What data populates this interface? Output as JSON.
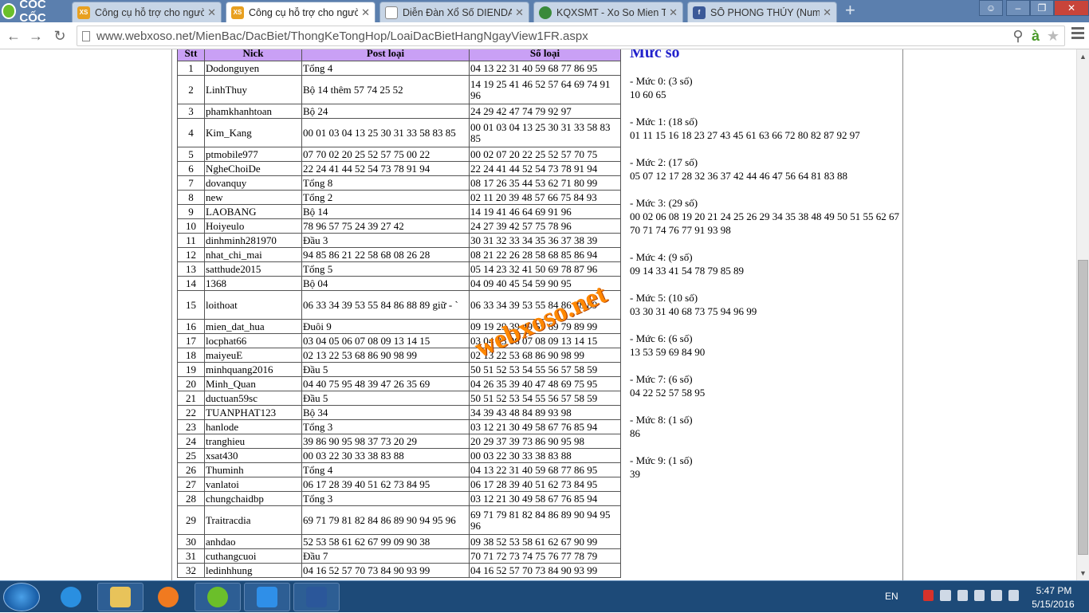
{
  "browser": {
    "brand": "CỐC CỐC",
    "tabs": [
      {
        "label": "Công cụ hỗ trợ cho người",
        "icon": "xoso-favicon",
        "active": false
      },
      {
        "label": "Công cụ hỗ trợ cho người",
        "icon": "xoso-favicon",
        "active": true
      },
      {
        "label": "Diễn Đàn Xổ Số DIENDAN",
        "icon": "page-icon",
        "active": false
      },
      {
        "label": "KQXSMT - Xo So Mien Tru",
        "icon": "kqxs-favicon",
        "active": false
      },
      {
        "label": "SỐ PHONG THỦY (Numer",
        "icon": "facebook-icon",
        "active": false
      }
    ],
    "url": "www.webxoso.net/MienBac/DacBiet/ThongKeTongHop/LoaiDacBietHangNgayView1FR.aspx"
  },
  "table": {
    "headers": [
      "Stt",
      "Nick",
      "Post loại",
      "Số loại"
    ],
    "rows": [
      {
        "stt": "1",
        "nick": "Dodonguyen",
        "post": "Tổng 4",
        "so": "04 13 22 31 40 59 68 77 86 95"
      },
      {
        "stt": "2",
        "nick": "LinhThuy",
        "post": "Bộ 14 thêm 57 74 25 52",
        "so": "14 19 25 41 46 52 57 64 69 74 91 96"
      },
      {
        "stt": "3",
        "nick": "phamkhanhtoan",
        "post": "Bộ 24",
        "so": "24 29 42 47 74 79 92 97"
      },
      {
        "stt": "4",
        "nick": "Kim_Kang",
        "post": "00 01 03 04 13 25 30 31 33 58 83 85",
        "so": "00 01 03 04 13 25 30 31 33 58 83 85"
      },
      {
        "stt": "5",
        "nick": "ptmobile977",
        "post": "07 70 02 20 25 52 57 75 00 22",
        "so": "00 02 07 20 22 25 52 57 70 75"
      },
      {
        "stt": "6",
        "nick": "NgheChoiDe",
        "post": "22 24 41 44 52 54 73 78 91 94",
        "so": "22 24 41 44 52 54 73 78 91 94"
      },
      {
        "stt": "7",
        "nick": "dovanquy",
        "post": "Tổng 8",
        "so": "08 17 26 35 44 53 62 71 80 99"
      },
      {
        "stt": "8",
        "nick": "new",
        "post": "Tổng 2",
        "so": "02 11 20 39 48 57 66 75 84 93"
      },
      {
        "stt": "9",
        "nick": "LAOBANG",
        "post": "Bộ 14",
        "so": "14 19 41 46 64 69 91 96"
      },
      {
        "stt": "10",
        "nick": "Hoiyeulo",
        "post": "78 96 57 75 24 39 27 42",
        "so": "24 27 39 42 57 75 78 96"
      },
      {
        "stt": "11",
        "nick": "dinhminh281970",
        "post": "Đầu 3",
        "so": "30 31 32 33 34 35 36 37 38 39"
      },
      {
        "stt": "12",
        "nick": "nhat_chi_mai",
        "post": "94 85 86 21 22 58 68 08 26 28",
        "so": "08 21 22 26 28 58 68 85 86 94"
      },
      {
        "stt": "13",
        "nick": "satthude2015",
        "post": "Tổng 5",
        "so": "05 14 23 32 41 50 69 78 87 96"
      },
      {
        "stt": "14",
        "nick": "1368",
        "post": "Bộ 04",
        "so": "04 09 40 45 54 59 90 95"
      },
      {
        "stt": "15",
        "nick": "loithoat",
        "post": "06 33 34 39 53 55 84 86 88 89 giữ - `",
        "so": "06 33 34 39 53 55 84 86 88 89"
      },
      {
        "stt": "16",
        "nick": "mien_dat_hua",
        "post": "Đuôi 9",
        "so": "09 19 29 39 49 59 69 79 89 99"
      },
      {
        "stt": "17",
        "nick": "locphat66",
        "post": "03 04 05 06 07 08 09 13 14 15",
        "so": "03 04 05 06 07 08 09 13 14 15"
      },
      {
        "stt": "18",
        "nick": "maiyeuE",
        "post": "02 13 22 53 68 86 90 98 99",
        "so": "02 13 22 53 68 86 90 98 99"
      },
      {
        "stt": "19",
        "nick": "minhquang2016",
        "post": "Đầu 5",
        "so": "50 51 52 53 54 55 56 57 58 59"
      },
      {
        "stt": "20",
        "nick": "Minh_Quan",
        "post": "04 40 75 95 48 39 47 26 35 69",
        "so": "04 26 35 39 40 47 48 69 75 95"
      },
      {
        "stt": "21",
        "nick": "ductuan59sc",
        "post": "Đầu 5",
        "so": "50 51 52 53 54 55 56 57 58 59"
      },
      {
        "stt": "22",
        "nick": "TUANPHAT123",
        "post": "Bộ 34",
        "so": "34 39 43 48 84 89 93 98"
      },
      {
        "stt": "23",
        "nick": "hanlode",
        "post": "Tổng 3",
        "so": "03 12 21 30 49 58 67 76 85 94"
      },
      {
        "stt": "24",
        "nick": "tranghieu",
        "post": "39 86 90 95 98 37 73 20 29",
        "so": "20 29 37 39 73 86 90 95 98"
      },
      {
        "stt": "25",
        "nick": "xsat430",
        "post": "00 03 22 30 33 38 83 88",
        "so": "00 03 22 30 33 38 83 88"
      },
      {
        "stt": "26",
        "nick": "Thuminh",
        "post": "Tổng 4",
        "so": "04 13 22 31 40 59 68 77 86 95"
      },
      {
        "stt": "27",
        "nick": "vanlatoi",
        "post": "06 17 28 39 40 51 62 73 84 95",
        "so": "06 17 28 39 40 51 62 73 84 95"
      },
      {
        "stt": "28",
        "nick": "chungchaidbp",
        "post": "Tổng 3",
        "so": "03 12 21 30 49 58 67 76 85 94"
      },
      {
        "stt": "29",
        "nick": "Traitracdia",
        "post": "69 71 79 81 82 84 86 89 90 94 95 96",
        "so": "69 71 79 81 82 84 86 89 90 94 95 96"
      },
      {
        "stt": "30",
        "nick": "anhdao",
        "post": "52 53 58 61 62 67 99 09 90 38",
        "so": "09 38 52 53 58 61 62 67 90 99"
      },
      {
        "stt": "31",
        "nick": "cuthangcuoi",
        "post": "Đầu 7",
        "so": "70 71 72 73 74 75 76 77 78 79"
      },
      {
        "stt": "32",
        "nick": "ledinhhung",
        "post": "04 16 52 57 70 73 84 90 93 99",
        "so": "04 16 52 57 70 73 84 90 93 99"
      }
    ]
  },
  "muc_so": {
    "title": "Mức số",
    "groups": [
      {
        "label": "- Mức 0: (3 số)",
        "numbers": "10 60 65"
      },
      {
        "label": "- Mức 1: (18 số)",
        "numbers": "01 11 15 16 18 23 27 43 45 61 63 66 72 80 82 87 92 97"
      },
      {
        "label": "- Mức 2: (17 số)",
        "numbers": "05 07 12 17 28 32 36 37 42 44 46 47 56 64 81 83 88"
      },
      {
        "label": "- Mức 3: (29 số)",
        "numbers": "00 02 06 08 19 20 21 24 25 26 29 34 35 38 48 49 50 51 55 62 67 70 71 74 76 77 91 93 98"
      },
      {
        "label": "- Mức 4: (9 số)",
        "numbers": "09 14 33 41 54 78 79 85 89"
      },
      {
        "label": "- Mức 5: (10 số)",
        "numbers": "03 30 31 40 68 73 75 94 96 99"
      },
      {
        "label": "- Mức 6: (6 số)",
        "numbers": "13 53 59 69 84 90"
      },
      {
        "label": "- Mức 7: (6 số)",
        "numbers": "04 22 52 57 58 95"
      },
      {
        "label": "- Mức 8: (1 số)",
        "numbers": "86"
      },
      {
        "label": "- Mức 9: (1 số)",
        "numbers": "39"
      }
    ]
  },
  "watermark": "webxoso.net",
  "taskbar": {
    "language": "EN",
    "time": "5:47 PM",
    "date": "5/15/2016",
    "apps": [
      "explorer-icon",
      "ie-icon",
      "files-icon",
      "media-icon",
      "coccoc-icon",
      "zalo-icon",
      "word-icon"
    ]
  }
}
